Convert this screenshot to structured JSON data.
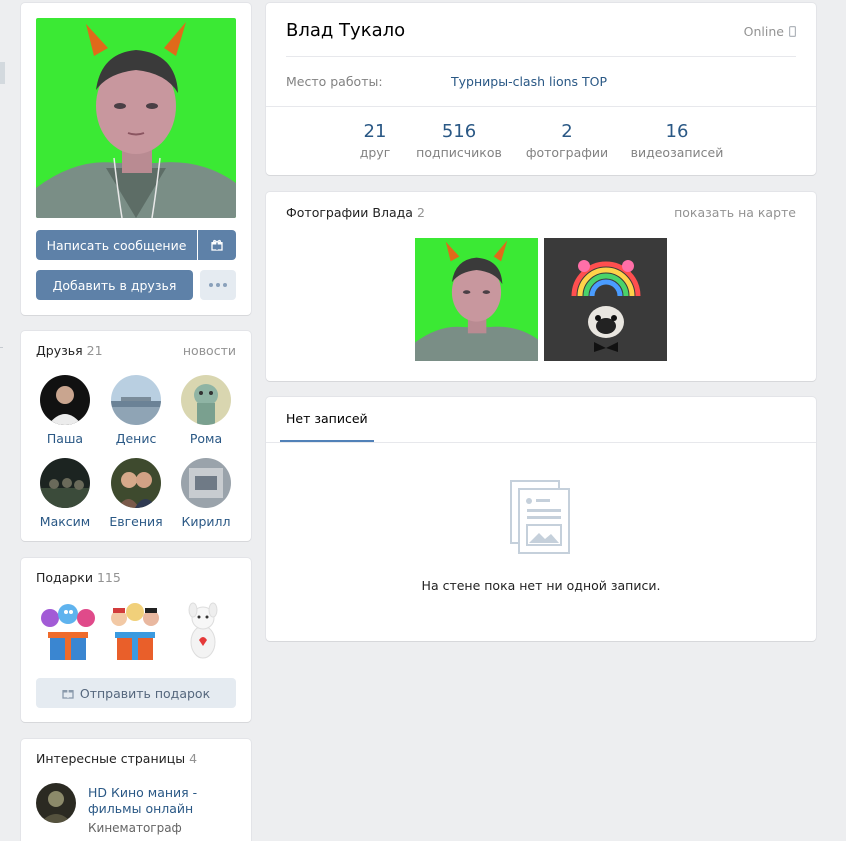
{
  "profile": {
    "name": "Влад Тукало",
    "status": "Online",
    "work_label": "Место работы:",
    "work_value": "Турниры-clash lions TOP",
    "counters": [
      {
        "num": "21",
        "label": "друг"
      },
      {
        "num": "516",
        "label": "подписчиков"
      },
      {
        "num": "2",
        "label": "фотографии"
      },
      {
        "num": "16",
        "label": "видеозаписей"
      }
    ]
  },
  "actions": {
    "message": "Написать сообщение",
    "add_friend": "Добавить в друзья"
  },
  "friends": {
    "title": "Друзья",
    "count": "21",
    "link": "новости",
    "items": [
      {
        "name": "Паша"
      },
      {
        "name": "Денис"
      },
      {
        "name": "Рома"
      },
      {
        "name": "Максим"
      },
      {
        "name": "Евгения"
      },
      {
        "name": "Кирилл"
      }
    ]
  },
  "gifts": {
    "title": "Подарки",
    "count": "115",
    "send_label": "Отправить подарок"
  },
  "pages": {
    "title": "Интересные страницы",
    "count": "4",
    "items": [
      {
        "name": "HD Кино мания - фильмы онлайн",
        "sub": "Кинематограф"
      }
    ]
  },
  "photos": {
    "title": "Фотографии Влада",
    "count": "2",
    "map_link": "показать на карте"
  },
  "wall": {
    "tab": "Нет записей",
    "empty": "На стене пока нет ни одной записи."
  },
  "colors": {
    "accent": "#5e81a8",
    "link": "#2a5885",
    "background": "#edeef0",
    "avatar_bg": "#3be934"
  }
}
